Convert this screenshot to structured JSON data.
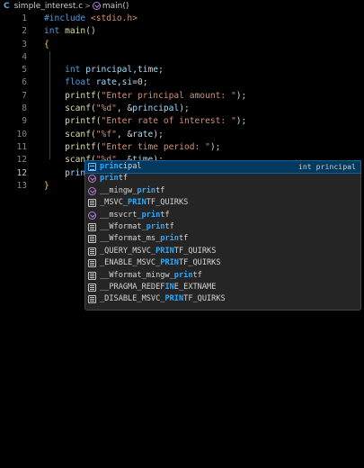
{
  "breadcrumb": {
    "file_icon_glyph": "C",
    "file": "simple_interest.c",
    "separator": ">",
    "function": "main()"
  },
  "editor": {
    "lines": [
      {
        "n": "1",
        "parts": [
          {
            "c": "kw",
            "t": "#include "
          },
          {
            "c": "str",
            "t": "<stdio.h>"
          }
        ]
      },
      {
        "n": "2",
        "parts": [
          {
            "c": "kw",
            "t": "int "
          },
          {
            "c": "fn",
            "t": "main"
          },
          {
            "c": "plain",
            "t": "()"
          }
        ]
      },
      {
        "n": "3",
        "parts": [
          {
            "c": "brace",
            "t": "{"
          }
        ]
      },
      {
        "n": "4",
        "parts": []
      },
      {
        "n": "5",
        "parts": [
          {
            "c": "plain",
            "t": "    "
          },
          {
            "c": "kw",
            "t": "int "
          },
          {
            "c": "var",
            "t": "principal"
          },
          {
            "c": "plain",
            "t": ","
          },
          {
            "c": "var",
            "t": "time"
          },
          {
            "c": "plain",
            "t": ";"
          }
        ]
      },
      {
        "n": "6",
        "parts": [
          {
            "c": "plain",
            "t": "    "
          },
          {
            "c": "kw",
            "t": "float "
          },
          {
            "c": "var",
            "t": "rate"
          },
          {
            "c": "plain",
            "t": ","
          },
          {
            "c": "var",
            "t": "si"
          },
          {
            "c": "plain",
            "t": "=0;"
          }
        ]
      },
      {
        "n": "7",
        "parts": [
          {
            "c": "plain",
            "t": "    "
          },
          {
            "c": "fn",
            "t": "printf"
          },
          {
            "c": "plain",
            "t": "("
          },
          {
            "c": "str",
            "t": "\"Enter principal amount: \""
          },
          {
            "c": "plain",
            "t": ");"
          }
        ]
      },
      {
        "n": "8",
        "parts": [
          {
            "c": "plain",
            "t": "    "
          },
          {
            "c": "fn",
            "t": "scanf"
          },
          {
            "c": "plain",
            "t": "("
          },
          {
            "c": "str",
            "t": "\"%d\""
          },
          {
            "c": "plain",
            "t": ", &"
          },
          {
            "c": "var",
            "t": "principal"
          },
          {
            "c": "plain",
            "t": ");"
          }
        ]
      },
      {
        "n": "9",
        "parts": [
          {
            "c": "plain",
            "t": "    "
          },
          {
            "c": "fn",
            "t": "printf"
          },
          {
            "c": "plain",
            "t": "("
          },
          {
            "c": "str",
            "t": "\"Enter rate of interest: \""
          },
          {
            "c": "plain",
            "t": ");"
          }
        ]
      },
      {
        "n": "10",
        "parts": [
          {
            "c": "plain",
            "t": "    "
          },
          {
            "c": "fn",
            "t": "scanf"
          },
          {
            "c": "plain",
            "t": "("
          },
          {
            "c": "str",
            "t": "\"%f\""
          },
          {
            "c": "plain",
            "t": ", &"
          },
          {
            "c": "var",
            "t": "rate"
          },
          {
            "c": "plain",
            "t": ");"
          }
        ]
      },
      {
        "n": "11",
        "parts": [
          {
            "c": "plain",
            "t": "    "
          },
          {
            "c": "fn",
            "t": "printf"
          },
          {
            "c": "plain",
            "t": "("
          },
          {
            "c": "str",
            "t": "\"Enter time period: \""
          },
          {
            "c": "plain",
            "t": ");"
          }
        ]
      },
      {
        "n": "12",
        "parts": [
          {
            "c": "plain",
            "t": "    "
          },
          {
            "c": "fn",
            "t": "scanf"
          },
          {
            "c": "plain",
            "t": "("
          },
          {
            "c": "str",
            "t": "\"%d\""
          },
          {
            "c": "plain",
            "t": ", &"
          },
          {
            "c": "var",
            "t": "time"
          },
          {
            "c": "plain",
            "t": ");"
          }
        ]
      },
      {
        "n": "12",
        "active": true,
        "parts": [
          {
            "c": "plain",
            "t": "    "
          },
          {
            "c": "var",
            "t": "prin"
          }
        ]
      },
      {
        "n": "13",
        "parts": [
          {
            "c": "brace",
            "t": "}"
          }
        ]
      }
    ]
  },
  "suggestions": [
    {
      "icon": "variable-icon",
      "pre": "",
      "match": "prin",
      "post": "cipal",
      "detail": "int principal",
      "selected": true
    },
    {
      "icon": "function-icon",
      "pre": "",
      "match": "prin",
      "post": "tf",
      "detail": ""
    },
    {
      "icon": "function-icon",
      "pre": "__mingw_",
      "match": "prin",
      "post": "tf",
      "detail": ""
    },
    {
      "icon": "text-icon",
      "pre": "_MSVC_",
      "match": "PRIN",
      "post": "TF_QUIRKS",
      "detail": ""
    },
    {
      "icon": "function-icon",
      "pre": "__msvcrt_",
      "match": "prin",
      "post": "tf",
      "detail": ""
    },
    {
      "icon": "text-icon",
      "pre": "__Wformat_",
      "match": "prin",
      "post": "tf",
      "detail": ""
    },
    {
      "icon": "text-icon",
      "pre": "__Wformat_ms_",
      "match": "prin",
      "post": "tf",
      "detail": ""
    },
    {
      "icon": "text-icon",
      "pre": "_QUERY_MSVC_",
      "match": "PRIN",
      "post": "TF_QUIRKS",
      "detail": ""
    },
    {
      "icon": "text-icon",
      "pre": "_ENABLE_MSVC_",
      "match": "PRIN",
      "post": "TF_QUIRKS",
      "detail": ""
    },
    {
      "icon": "text-icon",
      "pre": "__Wformat_mingw_",
      "match": "prin",
      "post": "tf",
      "detail": ""
    },
    {
      "icon": "text-icon",
      "pre": "__PRAGMA_REDEF",
      "match": "IN",
      "post": "E_EXTNAME",
      "detail": ""
    },
    {
      "icon": "text-icon",
      "pre": "_DISABLE_MSVC_",
      "match": "PRIN",
      "post": "TF_QUIRKS",
      "detail": ""
    }
  ]
}
